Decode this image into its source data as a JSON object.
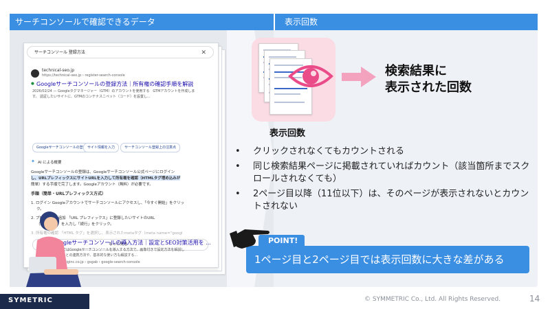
{
  "header": {
    "left_title": "サーチコンソールで確認できるデータ",
    "right_title": "表示回数"
  },
  "search_card": {
    "query": "サーチコンソール 登録方法",
    "close_icon": "✕",
    "site_name": "technical-seo.jp",
    "site_url": "https://technical-seo.jp › register-search-console",
    "result_title": "Googleサーチコンソールの登録方法｜所有権の確認手順を解説",
    "snippet_line1": "2026/02/24 — Googleタグマネージャー（GTM）のアカウントを使用する　GTMアカウントを作成しま",
    "snippet_line2": "す。 認証したいサイトに、GTMのコンテナスニペット（コード）を設置し...",
    "pills": [
      "Googleサーチコンソールの登録...",
      "サイト情報を入力",
      "サーチコンソール登録上の注意点"
    ],
    "ai_label": "AI による概要",
    "ai_text1": "Googleサーチコンソールの登録は、Googleサーチコンソール公式ページにログイン",
    "ai_text2": "し、URLプレフィックスにサイトURLを入力して所有権を確認（HTMLタグ埋め込みが",
    "ai_text3": "簡単）する手順で完了します。Googleアカウント（無料）が必要です。",
    "steps_title": "手順（簡単・URLプレフィックス方式）",
    "step1": "1. ログイン Googleアカウントでサーチコンソールにアクセスし、「今すぐ開始」をクリッ",
    "step1b": "ク。",
    "step2": "2. プロパティの追加 「URL プレフィックス」に登録したいサイトのURL",
    "step2b": "（https://...）を入力し「続行」をクリック。",
    "step3": "3. 所有権の確認 「HTML タグ」を選択し、表示されたmetaタグ（meta name=\"googl",
    "more_button": "もっと見る",
    "result2_site": "liginc.co.jp › gsgab › google-search-console",
    "result2_title": "Googleサーチコンソールの導入方法｜設定とSEO対策活用を ...",
    "result2_snippet1": "本記事ではGoogleサーチコンソールを導入する方法で、画像付きで設定方法を解説し",
    "result2_snippet2": "ティクスとの連携方法や、基本的な使い方も解説する..."
  },
  "icon_label": "表示回数",
  "result_text": [
    "検索結果に",
    "表示された回数"
  ],
  "bullets": [
    "クリックされなくてもカウントされる",
    "同じ検索結果ページに掲載されていればカウント（該当箇所までスクロールされなくても）",
    "2ページ目以降（11位以下）は、そのページが表示されないとカウントされない"
  ],
  "point": {
    "tag": "POINT!",
    "text": "1ページ目と2ページ目では表示回数に大きな差がある"
  },
  "footer": {
    "logo": "SYMETRIC",
    "copyright": "© SYMMETRIC Co., Ltd. All Rights Reserved.",
    "page_number": "14"
  },
  "colors": {
    "accent": "#3b8fe3",
    "icon_bg": "#fbdbe4",
    "eye": "#ea4c89",
    "arrow": "#f4a3bf"
  }
}
